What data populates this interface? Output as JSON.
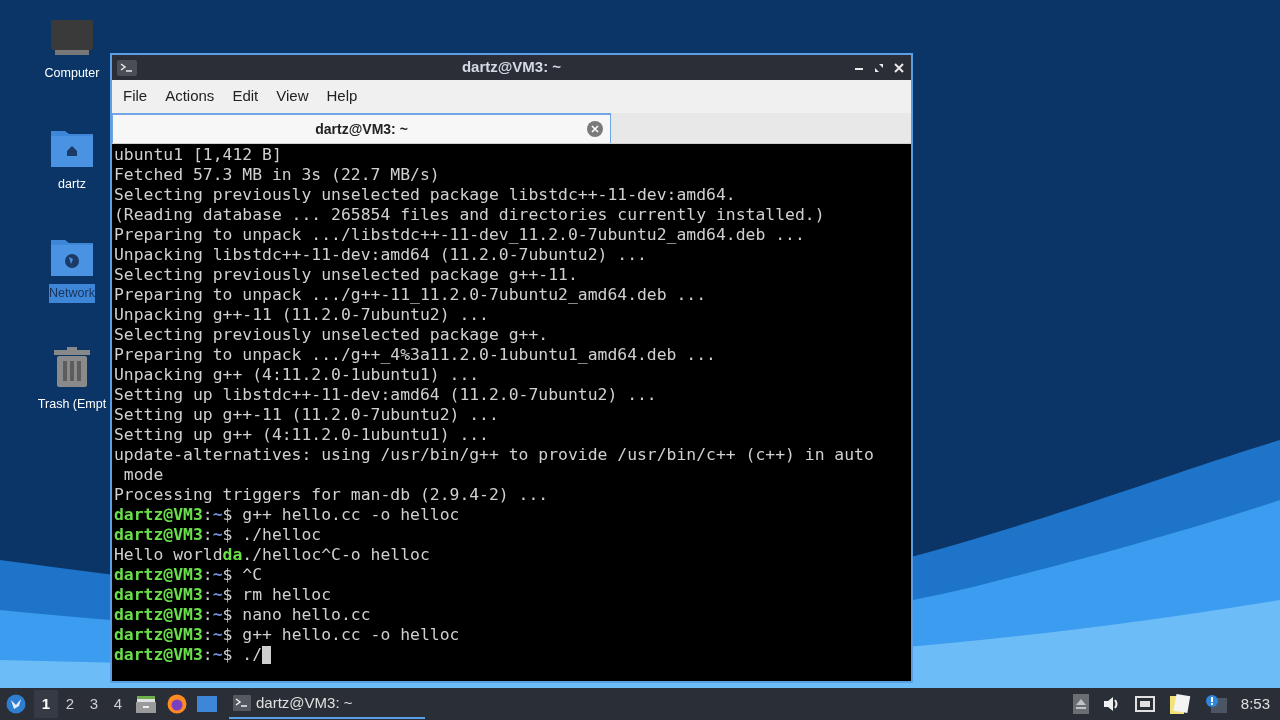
{
  "desktop_icons": [
    {
      "label": "Computer",
      "kind": "computer",
      "selected": false
    },
    {
      "label": "dartz",
      "kind": "home",
      "selected": false
    },
    {
      "label": "Network",
      "kind": "network",
      "selected": true
    },
    {
      "label": "Trash (Empt",
      "kind": "trash",
      "selected": false
    }
  ],
  "window": {
    "title": "dartz@VM3: ~",
    "menu": [
      "File",
      "Actions",
      "Edit",
      "View",
      "Help"
    ],
    "tabs": [
      {
        "label": "dartz@VM3: ~",
        "selected": true
      }
    ],
    "terminal": {
      "cursor_visible": true,
      "lines": [
        [
          {
            "kind": "plain",
            "text": "ubuntu1 [1,412 B]"
          }
        ],
        [
          {
            "kind": "plain",
            "text": "Fetched 57.3 MB in 3s (22.7 MB/s)"
          }
        ],
        [
          {
            "kind": "plain",
            "text": "Selecting previously unselected package libstdc++-11-dev:amd64."
          }
        ],
        [
          {
            "kind": "plain",
            "text": "(Reading database ... 265854 files and directories currently installed.)"
          }
        ],
        [
          {
            "kind": "plain",
            "text": "Preparing to unpack .../libstdc++-11-dev_11.2.0-7ubuntu2_amd64.deb ..."
          }
        ],
        [
          {
            "kind": "plain",
            "text": "Unpacking libstdc++-11-dev:amd64 (11.2.0-7ubuntu2) ..."
          }
        ],
        [
          {
            "kind": "plain",
            "text": "Selecting previously unselected package g++-11."
          }
        ],
        [
          {
            "kind": "plain",
            "text": "Preparing to unpack .../g++-11_11.2.0-7ubuntu2_amd64.deb ..."
          }
        ],
        [
          {
            "kind": "plain",
            "text": "Unpacking g++-11 (11.2.0-7ubuntu2) ..."
          }
        ],
        [
          {
            "kind": "plain",
            "text": "Selecting previously unselected package g++."
          }
        ],
        [
          {
            "kind": "plain",
            "text": "Preparing to unpack .../g++_4%3a11.2.0-1ubuntu1_amd64.deb ..."
          }
        ],
        [
          {
            "kind": "plain",
            "text": "Unpacking g++ (4:11.2.0-1ubuntu1) ..."
          }
        ],
        [
          {
            "kind": "plain",
            "text": "Setting up libstdc++-11-dev:amd64 (11.2.0-7ubuntu2) ..."
          }
        ],
        [
          {
            "kind": "plain",
            "text": "Setting up g++-11 (11.2.0-7ubuntu2) ..."
          }
        ],
        [
          {
            "kind": "plain",
            "text": "Setting up g++ (4:11.2.0-1ubuntu1) ..."
          }
        ],
        [
          {
            "kind": "plain",
            "text": "update-alternatives: using /usr/bin/g++ to provide /usr/bin/c++ (c++) in auto"
          }
        ],
        [
          {
            "kind": "plain",
            "text": " mode"
          }
        ],
        [
          {
            "kind": "plain",
            "text": "Processing triggers for man-db (2.9.4-2) ..."
          }
        ],
        [
          {
            "kind": "user",
            "text": "dartz@VM3"
          },
          {
            "kind": "plain",
            "text": ":"
          },
          {
            "kind": "path",
            "text": "~"
          },
          {
            "kind": "plain",
            "text": "$ g++ hello.cc -o helloc"
          }
        ],
        [
          {
            "kind": "user",
            "text": "dartz@VM3"
          },
          {
            "kind": "plain",
            "text": ":"
          },
          {
            "kind": "path",
            "text": "~"
          },
          {
            "kind": "plain",
            "text": "$ ./helloc"
          }
        ],
        [
          {
            "kind": "plain",
            "text": "Hello world"
          },
          {
            "kind": "user",
            "text": "da"
          },
          {
            "kind": "plain",
            "text": "./helloc^C-o helloc"
          }
        ],
        [
          {
            "kind": "user",
            "text": "dartz@VM3"
          },
          {
            "kind": "plain",
            "text": ":"
          },
          {
            "kind": "path",
            "text": "~"
          },
          {
            "kind": "plain",
            "text": "$ ^C"
          }
        ],
        [
          {
            "kind": "user",
            "text": "dartz@VM3"
          },
          {
            "kind": "plain",
            "text": ":"
          },
          {
            "kind": "path",
            "text": "~"
          },
          {
            "kind": "plain",
            "text": "$ rm helloc"
          }
        ],
        [
          {
            "kind": "user",
            "text": "dartz@VM3"
          },
          {
            "kind": "plain",
            "text": ":"
          },
          {
            "kind": "path",
            "text": "~"
          },
          {
            "kind": "plain",
            "text": "$ nano hello.cc"
          }
        ],
        [
          {
            "kind": "user",
            "text": "dartz@VM3"
          },
          {
            "kind": "plain",
            "text": ":"
          },
          {
            "kind": "path",
            "text": "~"
          },
          {
            "kind": "plain",
            "text": "$ g++ hello.cc -o helloc"
          }
        ],
        [
          {
            "kind": "user",
            "text": "dartz@VM3"
          },
          {
            "kind": "plain",
            "text": ":"
          },
          {
            "kind": "path",
            "text": "~"
          },
          {
            "kind": "plain",
            "text": "$ ./"
          }
        ]
      ]
    }
  },
  "taskbar": {
    "workspaces": [
      {
        "label": "1",
        "selected": true
      },
      {
        "label": "2",
        "selected": false
      },
      {
        "label": "3",
        "selected": false
      },
      {
        "label": "4",
        "selected": false
      }
    ],
    "tasks": [
      {
        "label": "dartz@VM3: ~",
        "selected": true
      }
    ],
    "clock": "8:53"
  }
}
